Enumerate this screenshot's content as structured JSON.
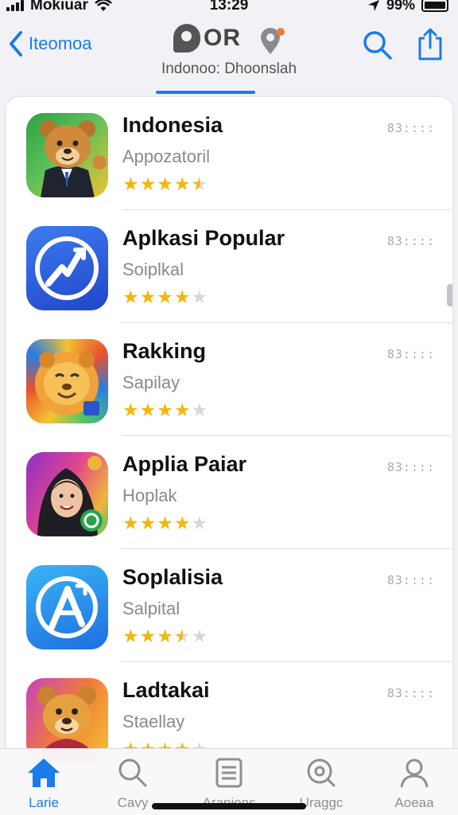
{
  "status": {
    "carrier": "Mokiuar",
    "time": "13:29",
    "battery": "99%"
  },
  "header": {
    "back_label": "Iteomoa",
    "brand": "OR",
    "subtitle": "Indonoo: Dhoonslah"
  },
  "apps": [
    {
      "name": "Indonesia",
      "subtitle": "Appozatoril",
      "rating": 4.5,
      "price": "83::::",
      "icon": "bear-suit-icon"
    },
    {
      "name": "Aplkasi Popular",
      "subtitle": "Soiplkal",
      "rating": 4,
      "price": "83::::",
      "icon": "blue-chart-icon"
    },
    {
      "name": "Rakking",
      "subtitle": "Sapilay",
      "rating": 4,
      "price": "83::::",
      "icon": "lion-icon"
    },
    {
      "name": "Applia Paiar",
      "subtitle": "Hoplak",
      "rating": 4,
      "price": "83::::",
      "icon": "hooded-man-icon"
    },
    {
      "name": "Soplalisia",
      "subtitle": "Salpital",
      "rating": 3.5,
      "price": "83::::",
      "icon": "app-store-icon"
    },
    {
      "name": "Ladtakai",
      "subtitle": "Staellay",
      "rating": 4,
      "price": "83::::",
      "icon": "bear-icon"
    }
  ],
  "tabs": [
    {
      "label": "Larie",
      "icon": "home-icon",
      "active": true
    },
    {
      "label": "Cavy",
      "icon": "search-icon",
      "active": false
    },
    {
      "label": "Aranions",
      "icon": "list-icon",
      "active": false
    },
    {
      "label": "Uraggc",
      "icon": "magnifier-icon",
      "active": false
    },
    {
      "label": "Aoeaa",
      "icon": "person-icon",
      "active": false
    }
  ],
  "colors": {
    "accent": "#1a7bea",
    "star": "#f5b50c"
  }
}
